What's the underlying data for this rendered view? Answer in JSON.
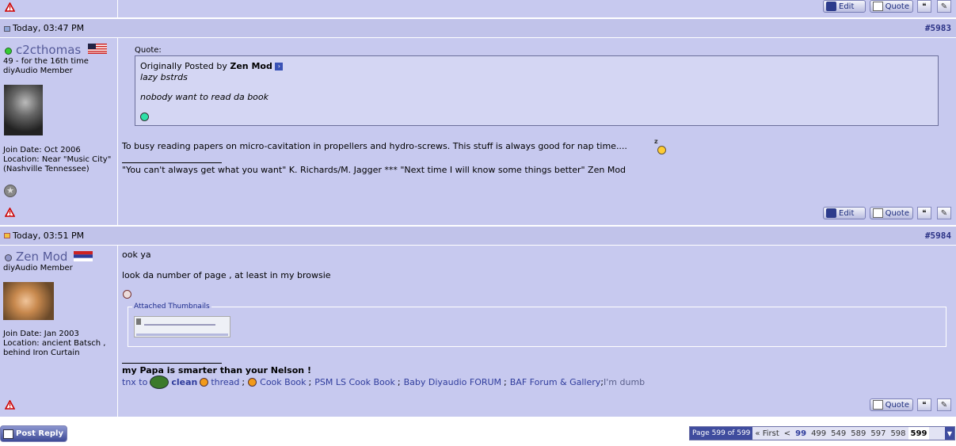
{
  "buttons": {
    "edit": "Edit",
    "quote": "Quote",
    "post_reply": "Post Reply"
  },
  "post1": {
    "date": "Today, 03:47 PM",
    "number": "#5983",
    "username": "c2cthomas",
    "user_title": "49 - for the 16th time",
    "user_rank": "diyAudio Member",
    "join_date": "Join Date: Oct 2006",
    "location": "Location: Near \"Music City\" (Nashville Tennessee)",
    "quote_label": "Quote:",
    "quote_prefix": "Originally Posted by",
    "quote_author": "Zen Mod",
    "quote_line1": "lazy bstrds",
    "quote_line2": "nobody want to read da book",
    "body": "To busy reading papers on micro-cavitation in propellers and hydro-screws. This stuff is always good for nap time....",
    "signature": "\"You can't always get what you want\" K. Richards/M. Jagger *** \"Next time I will know some things better\" Zen Mod"
  },
  "post2": {
    "date": "Today, 03:51 PM",
    "number": "#5984",
    "username": "Zen Mod",
    "user_rank": "diyAudio Member",
    "join_date": "Join Date: Jan 2003",
    "location": "Location: ancient Batsch , behind Iron Curtain",
    "line1": "ook ya",
    "line2": "look da number of page , at least in my browsie",
    "attached_label": "Attached Thumbnails",
    "sig_bold": "my Papa is smarter than your Nelson !",
    "sig_tnx": "tnx to",
    "sig_clean": "clean",
    "sig_links": [
      "thread",
      "Cook Book",
      "PSM LS Cook Book",
      "Baby Diyaudio FORUM",
      "BAF Forum & Gallery"
    ],
    "sig_sep": ";",
    "sig_end": "I'm dumb"
  },
  "pager": {
    "label": "Page 599 of 599",
    "first": "« First",
    "prev": "<",
    "pages": [
      "99",
      "499",
      "549",
      "589",
      "597",
      "598"
    ],
    "current": "599"
  }
}
